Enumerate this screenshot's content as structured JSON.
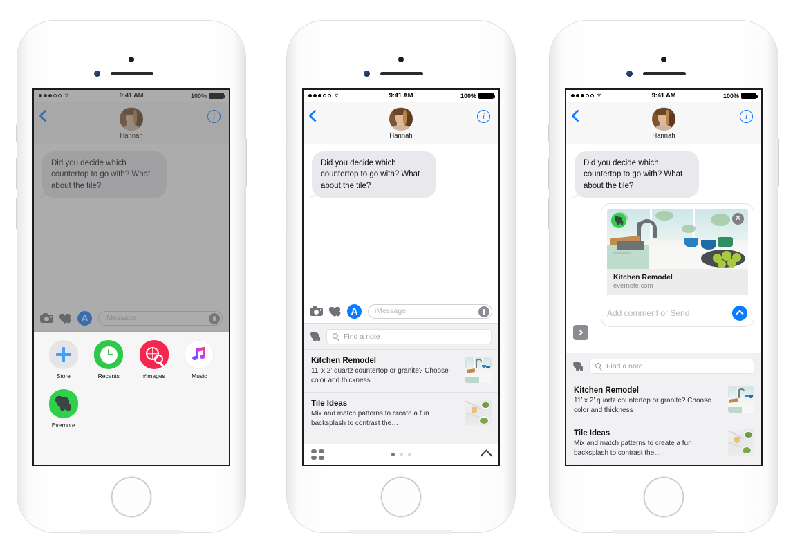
{
  "status_bar": {
    "time": "9:41 AM",
    "battery_label": "100%",
    "signal_icon": "signal-dots-icon",
    "wifi_icon": "wifi-icon"
  },
  "nav": {
    "back_icon": "back-chevron-icon",
    "info_icon": "info-circle-icon",
    "contact_name": "Hannah",
    "avatar_icon": "contact-avatar"
  },
  "conversation": {
    "incoming_message": "Did you decide which countertop to go with? What about the tile?"
  },
  "input_bar": {
    "camera_icon": "camera-icon",
    "digital_touch_icon": "heart-hand-icon",
    "app_store_icon": "imessage-app-store-icon",
    "placeholder": "iMessage",
    "mic_icon": "microphone-icon"
  },
  "app_drawer": {
    "apps": [
      {
        "label": "Store",
        "icon": "plus-store-icon"
      },
      {
        "label": "Recents",
        "icon": "clock-recents-icon"
      },
      {
        "label": "#images",
        "icon": "hash-images-icon"
      },
      {
        "label": "Music",
        "icon": "music-note-icon"
      },
      {
        "label": "Evernote",
        "icon": "evernote-elephant-icon"
      }
    ]
  },
  "evernote_extension": {
    "elephant_icon": "evernote-elephant-icon",
    "search_icon": "magnifier-icon",
    "search_placeholder": "Find a note",
    "notes": [
      {
        "title": "Kitchen Remodel",
        "snippet": "11’ x 2’ quartz countertop or granite? Choose color and thickness",
        "thumbnail": "kitchen-counter-thumbnail"
      },
      {
        "title": "Tile Ideas",
        "snippet": "Mix and match patterns to create a fun backsplash to contrast the…",
        "thumbnail": "marble-tile-thumbnail"
      }
    ],
    "footer": {
      "grid_icon": "app-grid-icon",
      "page_dots": 3,
      "active_dot": 1,
      "expand_icon": "chevron-up-icon"
    }
  },
  "share_card": {
    "badge_icon": "evernote-elephant-badge",
    "close_icon": "close-x-icon",
    "title": "Kitchen Remodel",
    "domain": "evernote.com",
    "compose_placeholder": "Add comment or Send",
    "send_icon": "send-arrow-up-icon",
    "expand_icon": "chevron-right-icon",
    "image": "kitchen-remodel-photo"
  },
  "colors": {
    "ios_blue": "#0b7bff",
    "evernote_green": "#2fd14a",
    "bubble_gray": "#e8e8ed",
    "images_red": "#f5274f",
    "recents_green": "#2fc84b"
  }
}
